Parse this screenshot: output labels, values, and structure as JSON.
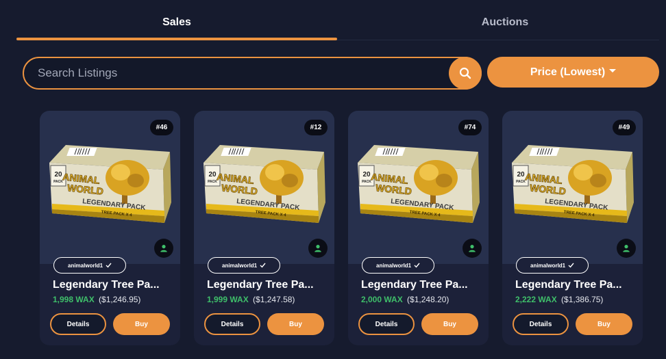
{
  "tabs": [
    {
      "label": "Sales",
      "active": true
    },
    {
      "label": "Auctions",
      "active": false
    }
  ],
  "search": {
    "placeholder": "Search Listings",
    "value": ""
  },
  "sort": {
    "label": "Price (Lowest)"
  },
  "colors": {
    "accent": "#ec9340",
    "price_green": "#3fbf6a",
    "background": "#161b2e",
    "card": "#1c2139"
  },
  "listings": [
    {
      "badge": "#46",
      "collection": "animalworld1",
      "name": "Legendary Tree Pa...",
      "price_wax": "1,998 WAX",
      "price_usd": "($1,246.95)",
      "details_label": "Details",
      "buy_label": "Buy"
    },
    {
      "badge": "#12",
      "collection": "animalworld1",
      "name": "Legendary Tree Pa...",
      "price_wax": "1,999 WAX",
      "price_usd": "($1,247.58)",
      "details_label": "Details",
      "buy_label": "Buy"
    },
    {
      "badge": "#74",
      "collection": "animalworld1",
      "name": "Legendary Tree Pa...",
      "price_wax": "2,000 WAX",
      "price_usd": "($1,248.20)",
      "details_label": "Details",
      "buy_label": "Buy"
    },
    {
      "badge": "#49",
      "collection": "animalworld1",
      "name": "Legendary Tree Pa...",
      "price_wax": "2,222 WAX",
      "price_usd": "($1,386.75)",
      "details_label": "Details",
      "buy_label": "Buy"
    }
  ],
  "pack_art": {
    "count": "20",
    "count_sub": "PACK",
    "title_line1": "ANIMAL",
    "title_line2": "WORLD",
    "subtitle": "LEGENDARY PACK",
    "banner": "TREE PACK X 4"
  }
}
